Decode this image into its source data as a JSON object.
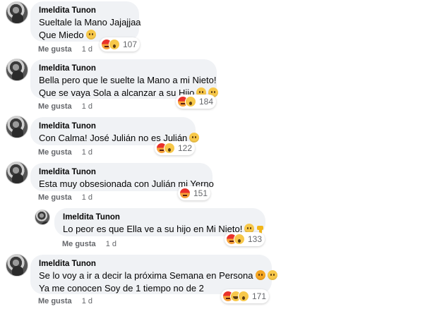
{
  "comments": [
    {
      "author": "Imeldita Tunon",
      "lines": [
        "Sueltale la Mano Jajajjaa",
        "Que Miedo"
      ],
      "line_emoji": [
        [],
        [
          "worried"
        ]
      ],
      "reactions": [
        "angry",
        "wow"
      ],
      "reaction_count": "107",
      "like_label": "Me gusta",
      "time": "1 d"
    },
    {
      "author": "Imeldita Tunon",
      "lines": [
        "Bella pero que le suelte la Mano a mi Nieto!",
        "Que se vaya Sola a alcanzar a su Hijo"
      ],
      "line_emoji": [
        [],
        [
          "grimace",
          "worried"
        ]
      ],
      "reactions": [
        "angry",
        "wow"
      ],
      "reaction_count": "184",
      "like_label": "Me gusta",
      "time": "1 d"
    },
    {
      "author": "Imeldita Tunon",
      "lines": [
        "Con Calma! José Julián no es Julián"
      ],
      "line_emoji": [
        [
          "grimace"
        ]
      ],
      "reactions": [
        "angry",
        "wow"
      ],
      "reaction_count": "122",
      "like_label": "Me gusta",
      "time": "1 d"
    },
    {
      "author": "Imeldita Tunon",
      "lines": [
        "Esta muy obsesionada con Julián mi Yerno"
      ],
      "line_emoji": [
        []
      ],
      "reactions": [
        "angry"
      ],
      "reaction_count": "151",
      "like_label": "Me gusta",
      "time": "1 d"
    },
    {
      "author": "Imeldita Tunon",
      "lines": [
        "Lo peor es que Ella ve a su hijo en Mi Nieto!"
      ],
      "line_emoji": [
        [
          "grimace",
          "thumbs-down"
        ]
      ],
      "reactions": [
        "angry",
        "wow"
      ],
      "reaction_count": "133",
      "like_label": "Me gusta",
      "time": "1 d",
      "reply": true
    },
    {
      "author": "Imeldita Tunon",
      "lines": [
        "Se lo voy a ir a decir la próxima Semana en Persona",
        "Ya me conocen Soy de 1 tiempo no de 2"
      ],
      "line_emoji": [
        [
          "smiling-hearts",
          "grinning"
        ],
        []
      ],
      "reactions": [
        "angry",
        "haha",
        "wow"
      ],
      "reaction_count": "171",
      "like_label": "Me gusta",
      "time": "1 d"
    }
  ]
}
